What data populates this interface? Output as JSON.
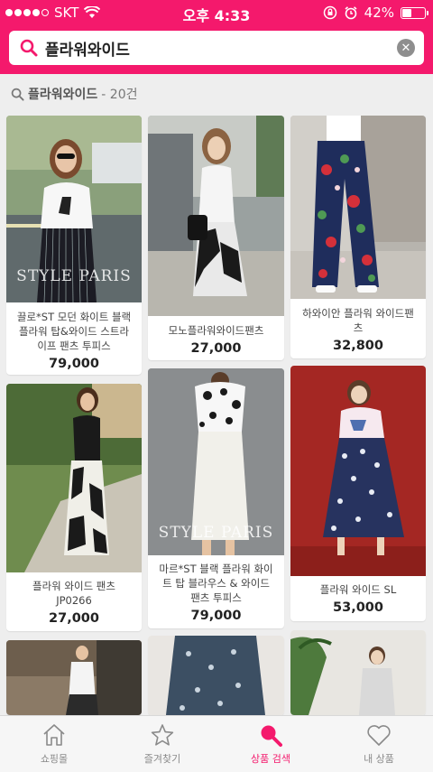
{
  "status_bar": {
    "carrier": "SKT",
    "time": "오후 4:33",
    "battery": "42%",
    "battery_level": 0.42
  },
  "search": {
    "value": "플라워와이드",
    "icon": "search-icon",
    "clear_icon": "clear-icon"
  },
  "results": {
    "query": "플라워와이드",
    "count": "- 20건"
  },
  "products": [
    {
      "name": "끌로*ST 모던 화이트 블랙 플라워 탑&와이드 스트라이프 팬츠 투피스",
      "price": "79,000",
      "watermark": "STYLE PARIS"
    },
    {
      "name": "모노플라워와이드팬츠",
      "price": "27,000",
      "watermark": ""
    },
    {
      "name": "하와이안 플라워 와이드팬츠",
      "price": "32,800",
      "watermark": ""
    },
    {
      "name": "플라워 와이드 팬츠 JP0266",
      "price": "27,000",
      "watermark": ""
    },
    {
      "name": "마르*ST 블랙 플라워 화이트 탑 블라우스 & 와이드 팬츠 투피스",
      "price": "79,000",
      "watermark": "STYLE PARIS"
    },
    {
      "name": "플라워 와이드 SL",
      "price": "53,000",
      "watermark": ""
    }
  ],
  "tabbar": {
    "items": [
      {
        "label": "쇼핑몰",
        "icon": "home-icon"
      },
      {
        "label": "즐겨찾기",
        "icon": "star-icon"
      },
      {
        "label": "상품 검색",
        "icon": "search-icon"
      },
      {
        "label": "내 상품",
        "icon": "heart-icon"
      }
    ]
  },
  "colors": {
    "accent": "#f4196c",
    "tab_inactive": "#8a8a8a"
  }
}
